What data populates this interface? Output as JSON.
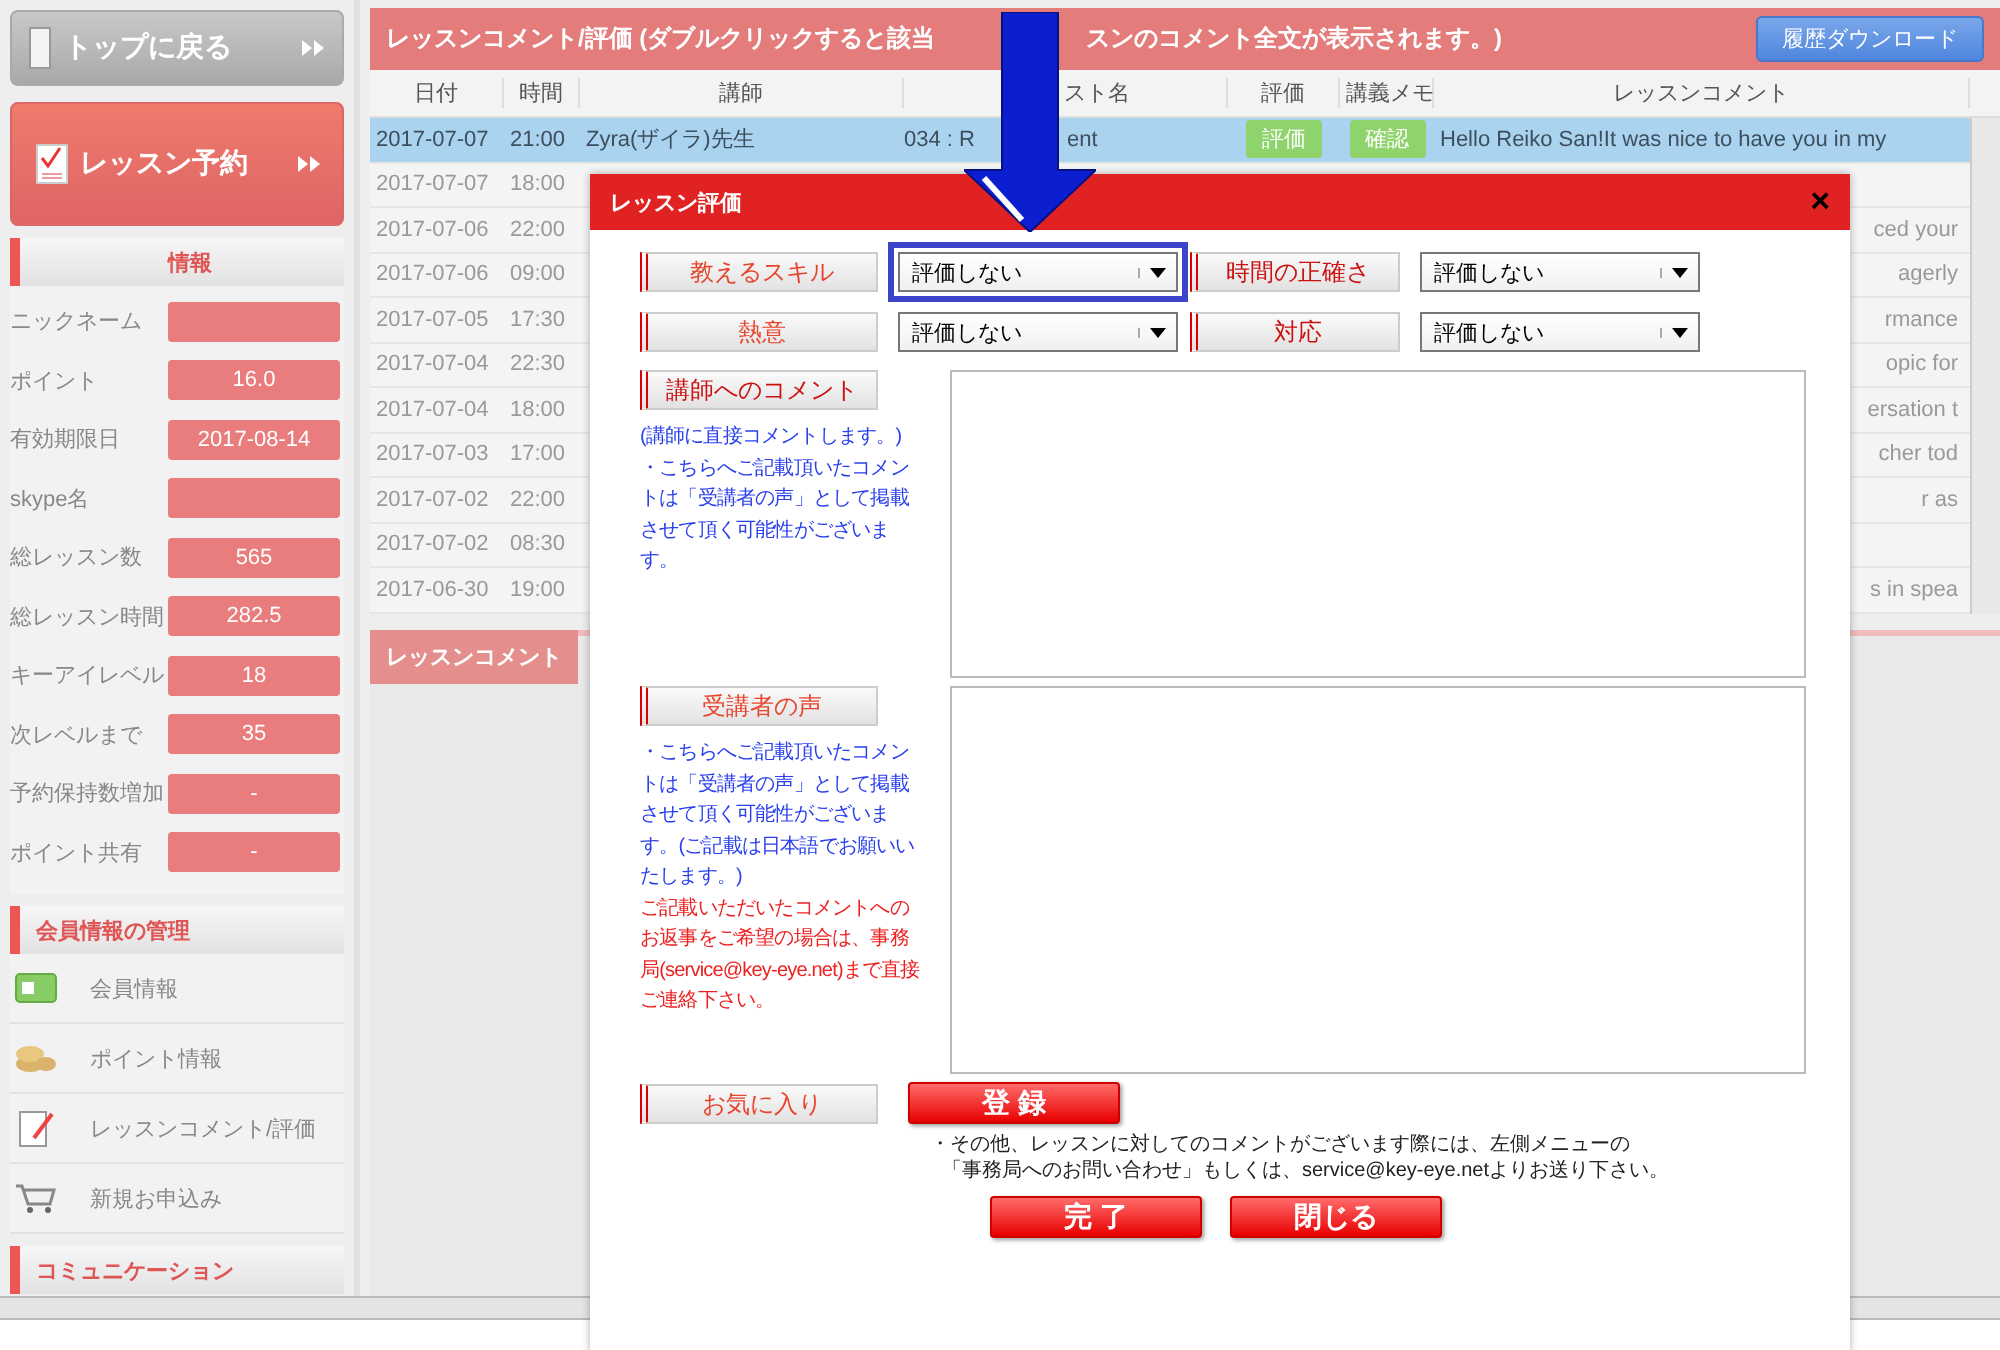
{
  "sidebar": {
    "top_button": "トップに戻る",
    "reserve_button": "レッスン予約",
    "info_title": "情報",
    "info": [
      {
        "label": "ニックネーム"
      },
      {
        "label": "ポイント",
        "value": "16.0"
      },
      {
        "label": "有効期限日",
        "value": "2017-08-14"
      },
      {
        "label": "skype名"
      },
      {
        "label": "総レッスン数",
        "value": "565"
      },
      {
        "label": "総レッスン時間",
        "value": "282.5"
      },
      {
        "label": "キーアイレベル",
        "value": "18"
      },
      {
        "label": "次レベルまで",
        "value": "35"
      },
      {
        "label": "予約保持数増加",
        "value": "-"
      },
      {
        "label": "ポイント共有",
        "value": "-"
      }
    ],
    "sections": [
      {
        "title": "会員情報の管理",
        "items": [
          {
            "label": "会員情報",
            "kind": "card"
          },
          {
            "label": "ポイント情報",
            "kind": "coins"
          },
          {
            "label": "レッスンコメント/評価",
            "kind": "clipboard"
          },
          {
            "label": "新規お申込み",
            "kind": "cart"
          }
        ]
      },
      {
        "title": "コミュニケーション"
      }
    ]
  },
  "main": {
    "title_parts": [
      "レッスンコメント/評価 (ダブルクリックすると該当",
      "スンのコメント全文が表示されます。)"
    ],
    "download_button": "履歴ダウンロード",
    "columns": [
      "日付",
      "時間",
      "講師",
      "スト名",
      "評価",
      "講義メモ",
      "レッスンコメント"
    ],
    "rows": [
      {
        "date": "2017-07-07",
        "time": "21:00",
        "teacher": "Zyra(ザイラ)先生",
        "lesson_parts": [
          "034 : R",
          "ent"
        ],
        "rating_button": "評価",
        "memo_button": "確認",
        "comment": "Hello Reiko San!It was nice to have you in my",
        "selected": true
      },
      {
        "date": "2017-07-07",
        "time": "18:00",
        "selected": false
      },
      {
        "date": "2017-07-06",
        "time": "22:00",
        "comment": "ced your",
        "selected": false
      },
      {
        "date": "2017-07-06",
        "time": "09:00",
        "comment": "agerly",
        "selected": false
      },
      {
        "date": "2017-07-05",
        "time": "17:30",
        "comment": "rmance",
        "selected": false
      },
      {
        "date": "2017-07-04",
        "time": "22:30",
        "comment": "opic for",
        "selected": false
      },
      {
        "date": "2017-07-04",
        "time": "18:00",
        "comment": "ersation t",
        "selected": false
      },
      {
        "date": "2017-07-03",
        "time": "17:00",
        "comment": "cher tod",
        "selected": false
      },
      {
        "date": "2017-07-02",
        "time": "22:00",
        "comment": "r  as",
        "selected": false
      },
      {
        "date": "2017-07-02",
        "time": "08:30",
        "selected": false
      },
      {
        "date": "2017-06-30",
        "time": "19:00",
        "comment": "s in spea",
        "selected": false
      }
    ],
    "bottom_tab": "レッスンコメント"
  },
  "dialog": {
    "title": "レッスン評価",
    "close": "×",
    "ratings": [
      {
        "label": "教えるスキル",
        "value": "評価しない",
        "highlighted": true
      },
      {
        "label": "時間の正確さ",
        "value": "評価しない",
        "highlighted": false
      },
      {
        "label": "熱意",
        "value": "評価しない",
        "highlighted": false
      },
      {
        "label": "対応",
        "value": "評価しない",
        "highlighted": false
      }
    ],
    "sections": [
      {
        "label": "講師へのコメント",
        "notes": [
          {
            "kind": "info",
            "text": "(講師に直接コメントします。)"
          },
          {
            "kind": "info",
            "text": "・こちらへご記載頂いたコメントは「受講者の声」として掲載させて頂く可能性がございます。"
          }
        ]
      },
      {
        "label": "受講者の声",
        "notes": [
          {
            "kind": "info",
            "text": "・こちらへご記載頂いたコメントは「受講者の声」として掲載させて頂く可能性がございます。(ご記載は日本語でお願いいたします。)"
          },
          {
            "kind": "alert",
            "text": "ご記載いただいたコメントへのお返事をご希望の場合は、事務局(service@key-eye.net)まで直接ご連絡下さい。"
          }
        ]
      }
    ],
    "favorite_label": "お気に入り",
    "register_button": "登 録",
    "footer_note_lines": [
      "・その他、レッスンに対してのコメントがございます際には、左側メニューの",
      "「事務局へのお問い合わせ」もしくは、service@key-eye.netよりお送り下さい。"
    ],
    "buttons": [
      "完 了",
      "閉じる"
    ]
  }
}
